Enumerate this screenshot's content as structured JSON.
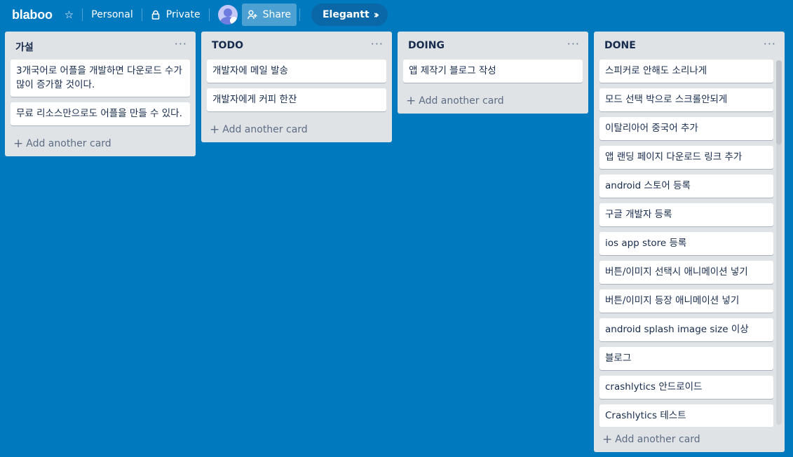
{
  "header": {
    "board_name": "blaboo",
    "star_icon": "star-icon",
    "team_label": "Personal",
    "visibility_label": "Private",
    "share_label": "Share",
    "powerup_label": "Elegantt"
  },
  "lists": {
    "hypothesis": {
      "title": "가설",
      "cards": [
        "3개국어로 어플을 개발하면 다운로드 수가 많이 증가할 것이다.",
        "무료 리소스만으로도 어플을 만들 수 있다."
      ],
      "add_label": "Add another card"
    },
    "todo": {
      "title": "TODO",
      "cards": [
        "개발자에 메일 발송",
        "개발자에게 커피 한잔"
      ],
      "add_label": "Add another card"
    },
    "doing": {
      "title": "DOING",
      "cards": [
        "앱 제작기 블로그 작성"
      ],
      "add_label": "Add another card"
    },
    "done": {
      "title": "DONE",
      "cards": [
        "스피커로 안해도 소리나게",
        "모드 선택 박으로 스크롤안되게",
        "이탈리아어 중국어 추가",
        "앱 랜딩 페이지 다운로드 링크 추가",
        "android 스토어 등록",
        "구글 개발자 등록",
        "ios app store 등록",
        "버튼/이미지 선택시 애니메이션 넣기",
        "버튼/이미지 등장 애니메이션 넣기",
        "android splash image size 이상",
        "블로그",
        "crashlytics 안드로이드",
        "Crashlytics 테스트"
      ],
      "add_label": "Add another card"
    }
  },
  "colors": {
    "board_background": "#0079bf",
    "list_background": "#dfe3e6",
    "card_background": "#ffffff"
  }
}
